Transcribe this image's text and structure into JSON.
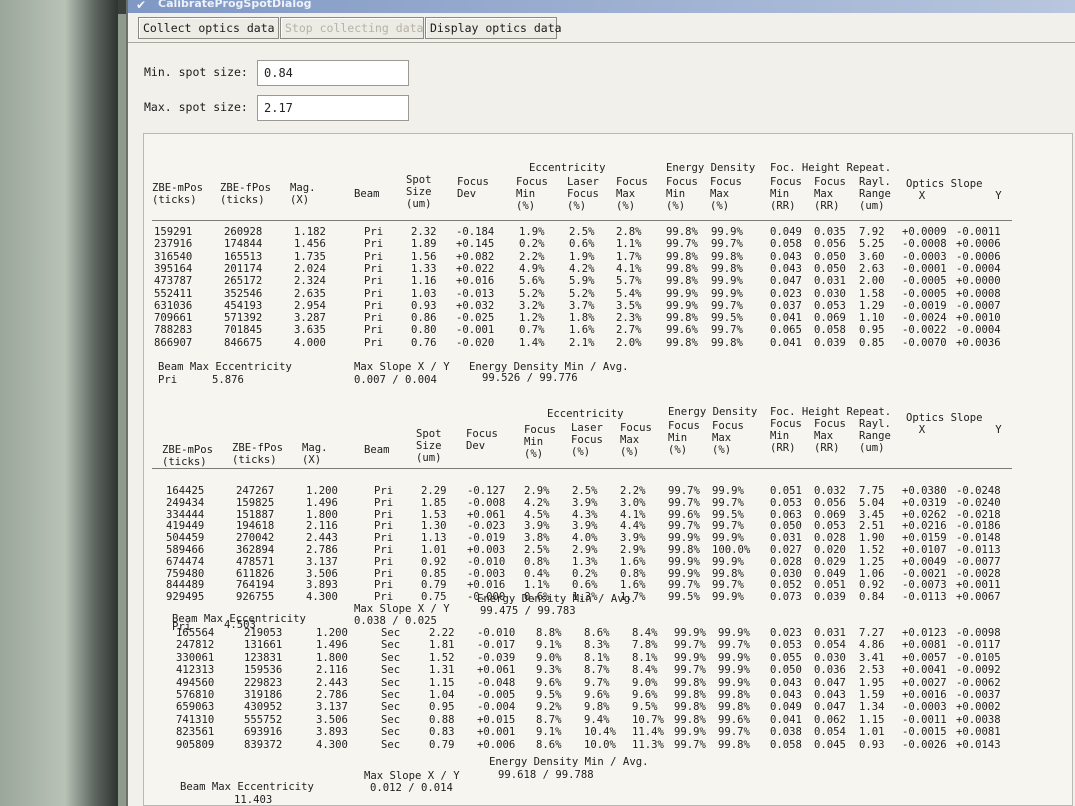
{
  "window": {
    "title": "CalibrateProgSpotDialog"
  },
  "tabs": [
    "Collect optics data",
    "Stop collecting data",
    "Display optics data"
  ],
  "spot": {
    "min_label": "Min. spot size:",
    "min_value": "0.84",
    "max_label": "Max. spot size:",
    "max_value": "2.17"
  },
  "headers": {
    "h1": "ZBE-mPos\n(ticks)",
    "h2": "ZBE-fPos\n(ticks)",
    "h3": "Mag.\n(X)",
    "h4": "Beam",
    "h5": "Spot\nSize\n(um)",
    "h6": "Focus\nDev",
    "ecc_group": "Eccentricity",
    "h7": "Focus\nMin\n(%)",
    "h8": "Laser\nFocus\n(%)",
    "h9": "Focus\nMax\n(%)",
    "ed_group": "Energy Density",
    "h10": "Focus\nMin\n(%)",
    "h11": "Focus\nMax\n(%)",
    "fh_group": "Foc. Height Repeat.",
    "h12": "Focus\nMin\n(RR)",
    "h13": "Focus\nMax\n(RR)",
    "h14": "Rayl.\nRange\n(um)",
    "h15": "Optics Slope\n  X           Y"
  },
  "table1": {
    "rows": [
      [
        "159291",
        "260928",
        "1.182",
        "Pri",
        "2.32",
        "-0.184",
        "1.9%",
        "2.5%",
        "2.8%",
        "99.8%",
        "99.9%",
        "0.049",
        "0.035",
        "7.92",
        "+0.0009",
        "-0.0011"
      ],
      [
        "237916",
        "174844",
        "1.456",
        "Pri",
        "1.89",
        "+0.145",
        "0.2%",
        "0.6%",
        "1.1%",
        "99.7%",
        "99.7%",
        "0.058",
        "0.056",
        "5.25",
        "-0.0008",
        "+0.0006"
      ],
      [
        "316540",
        "165513",
        "1.735",
        "Pri",
        "1.56",
        "+0.082",
        "2.2%",
        "1.9%",
        "1.7%",
        "99.8%",
        "99.8%",
        "0.043",
        "0.050",
        "3.60",
        "-0.0003",
        "-0.0006"
      ],
      [
        "395164",
        "201174",
        "2.024",
        "Pri",
        "1.33",
        "+0.022",
        "4.9%",
        "4.2%",
        "4.1%",
        "99.8%",
        "99.8%",
        "0.043",
        "0.050",
        "2.63",
        "-0.0001",
        "-0.0004"
      ],
      [
        "473787",
        "265172",
        "2.324",
        "Pri",
        "1.16",
        "+0.016",
        "5.6%",
        "5.9%",
        "5.7%",
        "99.8%",
        "99.9%",
        "0.047",
        "0.031",
        "2.00",
        "-0.0005",
        "+0.0000"
      ],
      [
        "552411",
        "352546",
        "2.635",
        "Pri",
        "1.03",
        "-0.013",
        "5.2%",
        "5.2%",
        "5.4%",
        "99.9%",
        "99.9%",
        "0.023",
        "0.030",
        "1.58",
        "-0.0005",
        "+0.0008"
      ],
      [
        "631036",
        "454193",
        "2.954",
        "Pri",
        "0.93",
        "+0.032",
        "3.2%",
        "3.7%",
        "3.5%",
        "99.9%",
        "99.7%",
        "0.037",
        "0.053",
        "1.29",
        "-0.0019",
        "-0.0007"
      ],
      [
        "709661",
        "571392",
        "3.287",
        "Pri",
        "0.86",
        "-0.025",
        "1.2%",
        "1.8%",
        "2.3%",
        "99.8%",
        "99.5%",
        "0.041",
        "0.069",
        "1.10",
        "-0.0024",
        "+0.0010"
      ],
      [
        "788283",
        "701845",
        "3.635",
        "Pri",
        "0.80",
        "-0.001",
        "0.7%",
        "1.6%",
        "2.7%",
        "99.6%",
        "99.7%",
        "0.065",
        "0.058",
        "0.95",
        "-0.0022",
        "-0.0004"
      ],
      [
        "866907",
        "846675",
        "4.000",
        "Pri",
        "0.76",
        "-0.020",
        "1.4%",
        "2.1%",
        "2.0%",
        "99.8%",
        "99.8%",
        "0.041",
        "0.039",
        "0.85",
        "-0.0070",
        "+0.0036"
      ]
    ],
    "sum_label": "Beam     Max Eccentricity",
    "sum_beam": "Pri",
    "sum_ecc": "5.876",
    "slope_label": "Max Slope X / Y",
    "slope_val": "0.007 / 0.004",
    "ed_label": "Energy Density Min / Avg.",
    "ed_val": "99.526 / 99.776"
  },
  "table2": {
    "rows": [
      [
        "164425",
        "247267",
        "1.200",
        "Pri",
        "2.29",
        "-0.127",
        "2.9%",
        "2.5%",
        "2.2%",
        "99.7%",
        "99.9%",
        "0.051",
        "0.032",
        "7.75",
        "+0.0380",
        "-0.0248"
      ],
      [
        "249434",
        "159825",
        "1.496",
        "Pri",
        "1.85",
        "-0.008",
        "4.2%",
        "3.9%",
        "3.0%",
        "99.7%",
        "99.7%",
        "0.053",
        "0.056",
        "5.04",
        "+0.0319",
        "-0.0240"
      ],
      [
        "334444",
        "151887",
        "1.800",
        "Pri",
        "1.53",
        "+0.061",
        "4.5%",
        "4.3%",
        "4.1%",
        "99.6%",
        "99.5%",
        "0.063",
        "0.069",
        "3.45",
        "+0.0262",
        "-0.0218"
      ],
      [
        "419449",
        "194618",
        "2.116",
        "Pri",
        "1.30",
        "-0.023",
        "3.9%",
        "3.9%",
        "4.4%",
        "99.7%",
        "99.7%",
        "0.050",
        "0.053",
        "2.51",
        "+0.0216",
        "-0.0186"
      ],
      [
        "504459",
        "270042",
        "2.443",
        "Pri",
        "1.13",
        "-0.019",
        "3.8%",
        "4.0%",
        "3.9%",
        "99.9%",
        "99.9%",
        "0.031",
        "0.028",
        "1.90",
        "+0.0159",
        "-0.0148"
      ],
      [
        "589466",
        "362894",
        "2.786",
        "Pri",
        "1.01",
        "+0.003",
        "2.5%",
        "2.9%",
        "2.9%",
        "99.8%",
        "100.0%",
        "0.027",
        "0.020",
        "1.52",
        "+0.0107",
        "-0.0113"
      ],
      [
        "674474",
        "478571",
        "3.137",
        "Pri",
        "0.92",
        "-0.010",
        "0.8%",
        "1.3%",
        "1.6%",
        "99.9%",
        "99.9%",
        "0.028",
        "0.029",
        "1.25",
        "+0.0049",
        "-0.0077"
      ],
      [
        "759480",
        "611826",
        "3.506",
        "Pri",
        "0.85",
        "-0.003",
        "0.4%",
        "0.2%",
        "0.8%",
        "99.9%",
        "99.8%",
        "0.030",
        "0.049",
        "1.06",
        "-0.0021",
        "-0.0028"
      ],
      [
        "844489",
        "764194",
        "3.893",
        "Pri",
        "0.79",
        "+0.016",
        "1.1%",
        "0.6%",
        "1.6%",
        "99.7%",
        "99.7%",
        "0.052",
        "0.051",
        "0.92",
        "-0.0073",
        "+0.0011"
      ],
      [
        "929495",
        "926755",
        "4.300",
        "Pri",
        "0.75",
        "-0.000",
        "0.6%",
        "1.3%",
        "1.7%",
        "99.5%",
        "99.9%",
        "0.073",
        "0.039",
        "0.84",
        "-0.0113",
        "+0.0067"
      ]
    ],
    "sum_label": "Beam     Max Eccentricity",
    "sum_beam": "Pri",
    "sum_ecc": "4.503",
    "slope_label": "Max Slope X / Y",
    "slope_val": "0.038 / 0.025",
    "ed_label": "Energy Density Min / Avg.",
    "ed_val": "99.475 / 99.783"
  },
  "table3": {
    "rows": [
      [
        "165564",
        "219053",
        "1.200",
        "Sec",
        "2.22",
        "-0.010",
        "8.8%",
        "8.6%",
        "8.4%",
        "99.9%",
        "99.9%",
        "0.023",
        "0.031",
        "7.27",
        "+0.0123",
        "-0.0098"
      ],
      [
        "247812",
        "131661",
        "1.496",
        "Sec",
        "1.81",
        "-0.017",
        "9.1%",
        "8.3%",
        "7.8%",
        "99.7%",
        "99.7%",
        "0.053",
        "0.054",
        "4.86",
        "+0.0081",
        "-0.0117"
      ],
      [
        "330061",
        "123831",
        "1.800",
        "Sec",
        "1.52",
        "-0.039",
        "9.0%",
        "8.1%",
        "8.1%",
        "99.9%",
        "99.9%",
        "0.055",
        "0.030",
        "3.41",
        "+0.0057",
        "-0.0105"
      ],
      [
        "412313",
        "159536",
        "2.116",
        "Sec",
        "1.31",
        "+0.061",
        "9.3%",
        "8.7%",
        "8.4%",
        "99.7%",
        "99.9%",
        "0.050",
        "0.036",
        "2.53",
        "+0.0041",
        "-0.0092"
      ],
      [
        "494560",
        "229823",
        "2.443",
        "Sec",
        "1.15",
        "-0.048",
        "9.6%",
        "9.7%",
        "9.0%",
        "99.8%",
        "99.9%",
        "0.043",
        "0.047",
        "1.95",
        "+0.0027",
        "-0.0062"
      ],
      [
        "576810",
        "319186",
        "2.786",
        "Sec",
        "1.04",
        "-0.005",
        "9.5%",
        "9.6%",
        "9.6%",
        "99.8%",
        "99.8%",
        "0.043",
        "0.043",
        "1.59",
        "+0.0016",
        "-0.0037"
      ],
      [
        "659063",
        "430952",
        "3.137",
        "Sec",
        "0.95",
        "-0.004",
        "9.2%",
        "9.8%",
        "9.5%",
        "99.8%",
        "99.8%",
        "0.049",
        "0.047",
        "1.34",
        "-0.0003",
        "+0.0002"
      ],
      [
        "741310",
        "555752",
        "3.506",
        "Sec",
        "0.88",
        "+0.015",
        "8.7%",
        "9.4%",
        "10.7%",
        "99.8%",
        "99.6%",
        "0.041",
        "0.062",
        "1.15",
        "-0.0011",
        "+0.0038"
      ],
      [
        "823561",
        "693916",
        "3.893",
        "Sec",
        "0.83",
        "+0.001",
        "9.1%",
        "10.4%",
        "11.4%",
        "99.9%",
        "99.7%",
        "0.038",
        "0.054",
        "1.01",
        "-0.0015",
        "+0.0081"
      ],
      [
        "905809",
        "839372",
        "4.300",
        "Sec",
        "0.79",
        "+0.006",
        "8.6%",
        "10.0%",
        "11.3%",
        "99.7%",
        "99.8%",
        "0.058",
        "0.045",
        "0.93",
        "-0.0026",
        "+0.0143"
      ]
    ],
    "sum_label": "Beam     Max Eccentricity",
    "sum_ecc": "11.403",
    "slope_label": "Max Slope X / Y",
    "slope_val": "0.012 / 0.014",
    "ed_label": "Energy Density Min / Avg.",
    "ed_val": "99.618 / 99.788"
  }
}
